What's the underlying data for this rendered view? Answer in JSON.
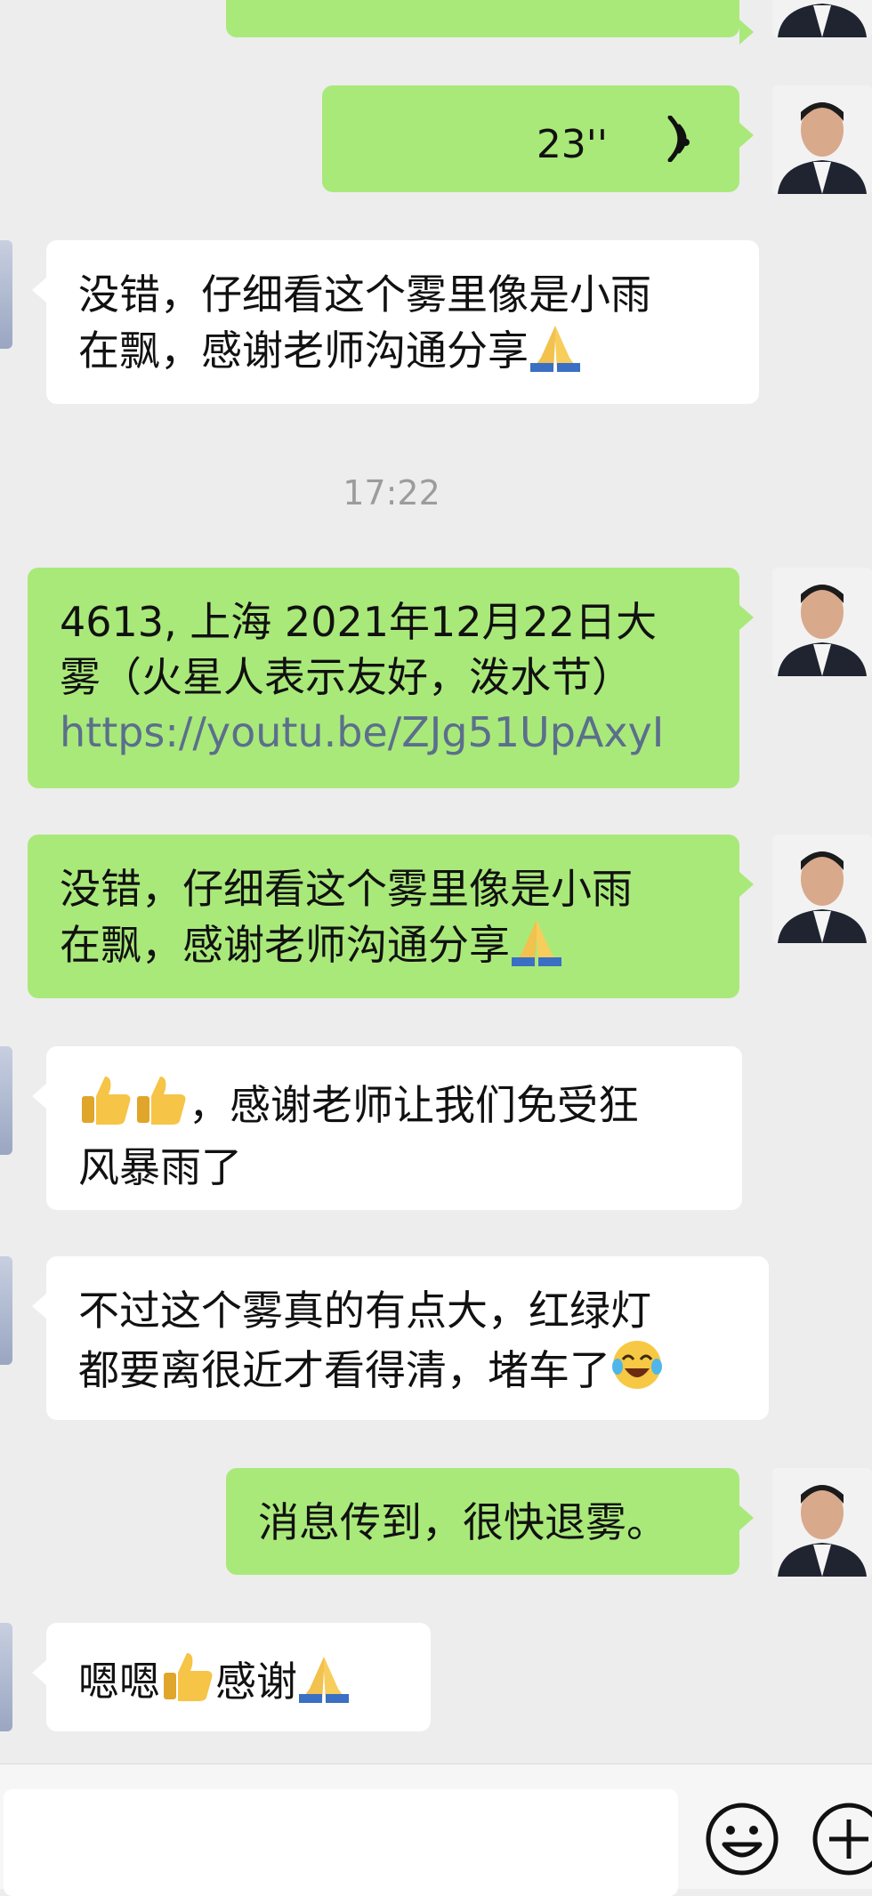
{
  "timestamp": "17:22",
  "voice_message": {
    "duration": "23''"
  },
  "messages": [
    {
      "side": "in",
      "lines": [
        "没错，仔细看这个雾里像是小雨",
        "在飘，感谢老师沟通分享"
      ]
    },
    {
      "side": "out",
      "lines": [
        "4613, 上海 2021年12月22日大",
        "雾（火星人表示友好，泼水节）"
      ],
      "link": "https://youtu.be/ZJg51UpAxyI"
    },
    {
      "side": "out",
      "lines": [
        "没错，仔细看这个雾里像是小雨",
        "在飘，感谢老师沟通分享"
      ]
    },
    {
      "side": "in",
      "lines": [
        "，感谢老师让我们免受狂",
        "风暴雨了"
      ]
    },
    {
      "side": "in",
      "lines": [
        "不过这个雾真的有点大，红绿灯",
        "都要离很近才看得清，堵车了"
      ]
    },
    {
      "side": "out",
      "lines": [
        "消息传到，很快退雾。"
      ]
    },
    {
      "side": "in",
      "parts": [
        "嗯嗯",
        "感谢"
      ]
    }
  ],
  "icons": {
    "pray": "folded-hands-emoji",
    "thumbs": "thumbs-up-emoji",
    "laugh": "crying-laughing-emoji",
    "voice": "voice-wave-icon",
    "emoji_button": "smiley-face-icon",
    "plus_button": "plus-circle-icon"
  },
  "colors": {
    "outgoing_bubble": "#a9e97a",
    "incoming_bubble": "#ffffff",
    "background": "#ededed",
    "link": "#5b6f8c"
  }
}
